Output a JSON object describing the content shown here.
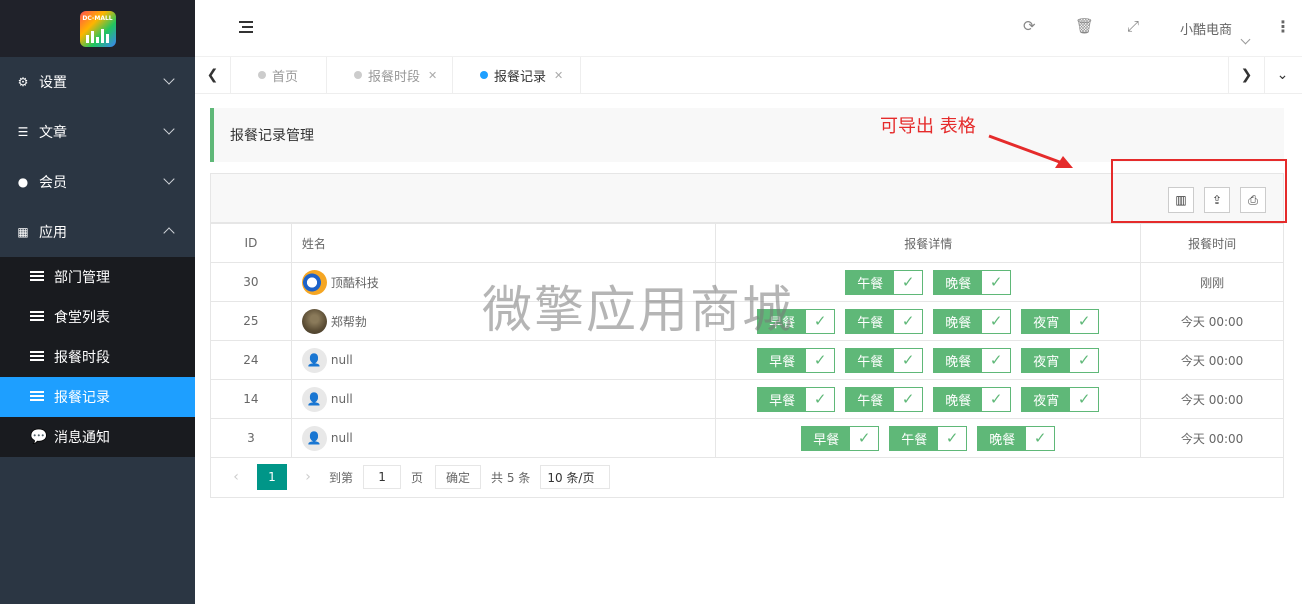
{
  "logo": {
    "text": "DC-MALL"
  },
  "sidebar": {
    "items": [
      {
        "label": "设置",
        "icon": "gears-icon",
        "expanded": false
      },
      {
        "label": "文章",
        "icon": "list-icon",
        "expanded": false
      },
      {
        "label": "会员",
        "icon": "user-icon",
        "expanded": false
      },
      {
        "label": "应用",
        "icon": "grid-icon",
        "expanded": true
      }
    ],
    "subitems": [
      {
        "label": "部门管理",
        "icon": "list-icon"
      },
      {
        "label": "食堂列表",
        "icon": "list-icon"
      },
      {
        "label": "报餐时段",
        "icon": "list-icon"
      },
      {
        "label": "报餐记录",
        "icon": "list-icon",
        "active": true
      },
      {
        "label": "消息通知",
        "icon": "comment-icon"
      }
    ]
  },
  "header": {
    "user": "小酷电商",
    "icons": [
      "refresh-icon",
      "trash-icon",
      "fullscreen-icon",
      "more-icon"
    ]
  },
  "tabs": [
    {
      "label": "首页",
      "closable": false
    },
    {
      "label": "报餐时段",
      "closable": true
    },
    {
      "label": "报餐记录",
      "closable": true,
      "active": true
    }
  ],
  "panel": {
    "title": "报餐记录管理"
  },
  "annotation": {
    "text": "可导出 表格"
  },
  "toolbar": {
    "icons": [
      "columns-icon",
      "export-icon",
      "print-icon"
    ]
  },
  "table": {
    "headers": {
      "id": "ID",
      "name": "姓名",
      "detail": "报餐详情",
      "time": "报餐时间"
    },
    "rows": [
      {
        "id": "30",
        "name": "顶酷科技",
        "avatar": "brand",
        "meals": [
          "午餐",
          "晚餐"
        ],
        "time": "刚刚"
      },
      {
        "id": "25",
        "name": "郑帮勃",
        "avatar": "photo",
        "meals": [
          "早餐",
          "午餐",
          "晚餐",
          "夜宵"
        ],
        "time": "今天 00:00"
      },
      {
        "id": "24",
        "name": "null",
        "avatar": "default",
        "meals": [
          "早餐",
          "午餐",
          "晚餐",
          "夜宵"
        ],
        "time": "今天 00:00"
      },
      {
        "id": "14",
        "name": "null",
        "avatar": "default",
        "meals": [
          "早餐",
          "午餐",
          "晚餐",
          "夜宵"
        ],
        "time": "今天 00:00"
      },
      {
        "id": "3",
        "name": "null",
        "avatar": "default",
        "meals": [
          "早餐",
          "午餐",
          "晚餐"
        ],
        "time": "今天 00:00"
      }
    ]
  },
  "pager": {
    "current": "1",
    "goto_prefix": "到第",
    "goto_value": "1",
    "goto_suffix": "页",
    "confirm": "确定",
    "total": "共 5 条",
    "page_size": "10 条/页"
  },
  "watermark": "微擎应用商城",
  "colors": {
    "accent": "#1e9fff",
    "success": "#5fb878",
    "pager": "#009688",
    "annotation": "#e52b2b"
  }
}
